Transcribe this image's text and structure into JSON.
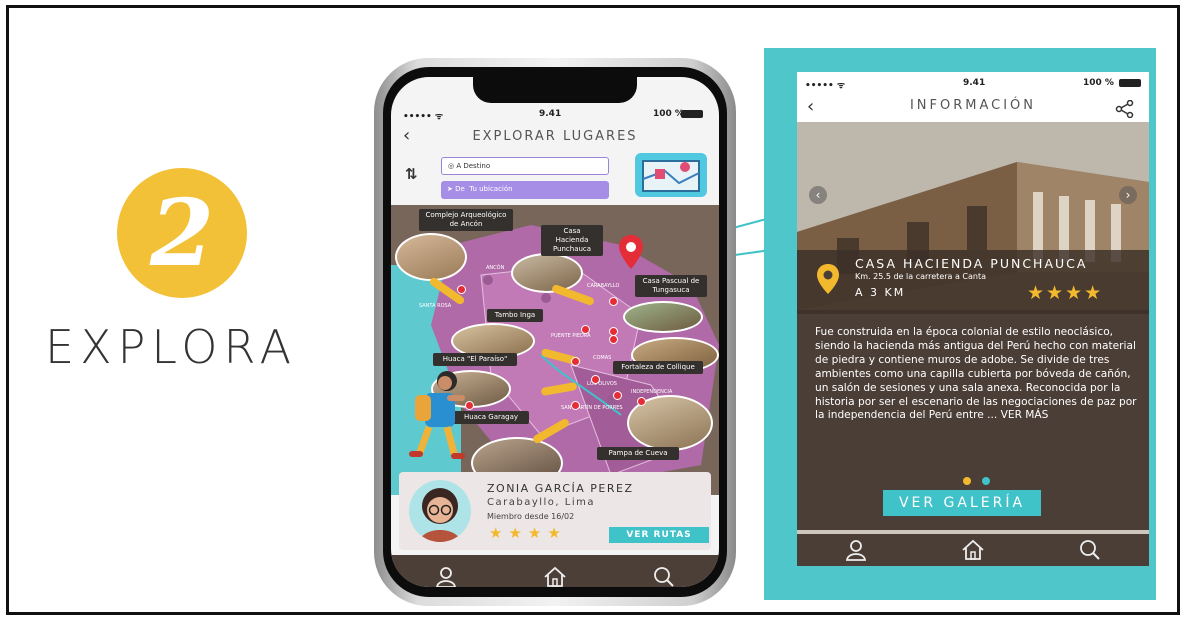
{
  "step": {
    "number": "2",
    "label": "EXPLORA"
  },
  "phone": {
    "status": {
      "carrier": "••••• ᯤ",
      "time": "9.41",
      "battery": "100 %"
    },
    "title": "EXPLORAR LUGARES",
    "destination_placeholder": "A Destino",
    "origin_prefix": "De",
    "origin_value": "Tu ubicación",
    "map_labels": [
      "Complejo Arqueológico de Ancón",
      "Casa Hacienda Punchauca",
      "Casa Pascual de Tungasuca",
      "Tambo Inga",
      "Huaca \"El Paraíso\"",
      "Fortaleza de Collique",
      "Huaca Garagay",
      "Pampa de Cueva"
    ],
    "map_places": [
      "ANCÓN",
      "SANTA ROSA",
      "CARABAYLLO",
      "PUENTE PIEDRA",
      "COMAS",
      "LOS OLIVOS",
      "INDEPENDENCIA",
      "SAN MARTÍN DE PORRES"
    ],
    "profile": {
      "name": "ZONIA GARCÍA PEREZ",
      "location": "Carabayllo, Lima",
      "member_since": "Miembro desde 16/02",
      "stars": "★★★★",
      "button": "VER RUTAS"
    },
    "tabs": [
      "profile-icon",
      "home-icon",
      "search-icon"
    ]
  },
  "detail": {
    "status": {
      "carrier": "••••• ᯤ",
      "time": "9.41",
      "battery": "100 %"
    },
    "title": "INFORMACIÓN",
    "place_name": "CASA HACIENDA PUNCHAUCA",
    "place_address": "Km. 25.5 de la carretera a Canta",
    "distance": "A 3 KM",
    "stars": "★★★★",
    "description": "Fue construida en la época colonial de estilo neoclásico, siendo la hacienda más antigua del Perú hecho con material de piedra y contiene muros de adobe. Se divide de tres ambientes como una capilla cubierta por bóveda de cañón, un salón de sesiones y una sala anexa. Reconocida por la historia por ser el escenario de las negociaciones de paz por la independencia del Perú entre ... VER MÁS",
    "gallery_button": "VER GALERÍA",
    "tabs": [
      "profile-icon",
      "home-icon",
      "search-icon"
    ]
  },
  "colors": {
    "teal": "#4fc6c9",
    "yellow": "#f3c137",
    "brown": "#4b3e37",
    "purple": "#a68ee6",
    "map_pink": "#b06aa7"
  }
}
